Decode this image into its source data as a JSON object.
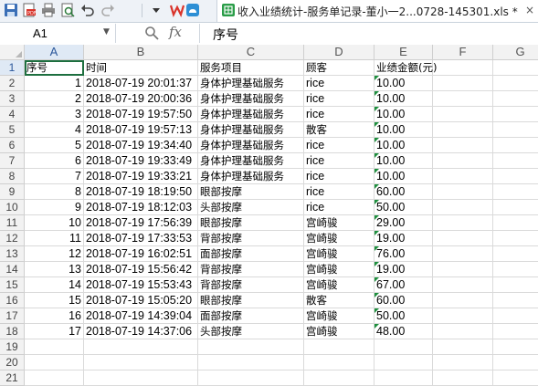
{
  "window": {
    "tab_title": "收入业绩统计-服务单记录-董小一2...0728-145301.xls *",
    "close_glyph": "×"
  },
  "toolbar": {
    "icons": [
      "save-icon",
      "pdf-icon",
      "print-icon",
      "print-preview-icon",
      "undo-icon",
      "redo-icon",
      "dropdown-icon",
      "wps-logo-icon",
      "cloud-icon",
      "spreadsheet-icon"
    ]
  },
  "formula_bar": {
    "cell_ref": "A1",
    "fx_label": "fx",
    "content": "序号"
  },
  "columns": [
    "A",
    "B",
    "C",
    "D",
    "E",
    "F",
    "G"
  ],
  "selected_cell": "A1",
  "header_row": [
    "序号",
    "时间",
    "服务项目",
    "顾客",
    "业绩金额(元)"
  ],
  "rows": [
    [
      "1",
      "2018-07-19 20:01:37",
      "身体护理基础服务",
      "rice",
      "10.00"
    ],
    [
      "2",
      "2018-07-19 20:00:36",
      "身体护理基础服务",
      "rice",
      "10.00"
    ],
    [
      "3",
      "2018-07-19 19:57:50",
      "身体护理基础服务",
      "rice",
      "10.00"
    ],
    [
      "4",
      "2018-07-19 19:57:13",
      "身体护理基础服务",
      "散客",
      "10.00"
    ],
    [
      "5",
      "2018-07-19 19:34:40",
      "身体护理基础服务",
      "rice",
      "10.00"
    ],
    [
      "6",
      "2018-07-19 19:33:49",
      "身体护理基础服务",
      "rice",
      "10.00"
    ],
    [
      "7",
      "2018-07-19 19:33:21",
      "身体护理基础服务",
      "rice",
      "10.00"
    ],
    [
      "8",
      "2018-07-19 18:19:50",
      "眼部按摩",
      "rice",
      "60.00"
    ],
    [
      "9",
      "2018-07-19 18:12:03",
      "头部按摩",
      "rice",
      "50.00"
    ],
    [
      "10",
      "2018-07-19 17:56:39",
      "眼部按摩",
      "宫崎骏",
      "29.00"
    ],
    [
      "11",
      "2018-07-19 17:33:53",
      "背部按摩",
      "宫崎骏",
      "19.00"
    ],
    [
      "12",
      "2018-07-19 16:02:51",
      "面部按摩",
      "宫崎骏",
      "76.00"
    ],
    [
      "13",
      "2018-07-19 15:56:42",
      "背部按摩",
      "宫崎骏",
      "19.00"
    ],
    [
      "14",
      "2018-07-19 15:53:43",
      "背部按摩",
      "宫崎骏",
      "67.00"
    ],
    [
      "15",
      "2018-07-19 15:05:20",
      "眼部按摩",
      "散客",
      "60.00"
    ],
    [
      "16",
      "2018-07-19 14:39:04",
      "面部按摩",
      "宫崎骏",
      "50.00"
    ],
    [
      "17",
      "2018-07-19 14:37:06",
      "头部按摩",
      "宫崎骏",
      "48.00"
    ]
  ],
  "row_numbers": [
    "1",
    "2",
    "3",
    "4",
    "5",
    "6",
    "7",
    "8",
    "9",
    "10",
    "11",
    "12",
    "13",
    "14",
    "15",
    "16",
    "17",
    "18",
    "19",
    "20",
    "21"
  ],
  "colors": {
    "accent": "#1d6f3f",
    "number_flag": "#1e8f3e",
    "header_bg": "#f2f2f2"
  }
}
